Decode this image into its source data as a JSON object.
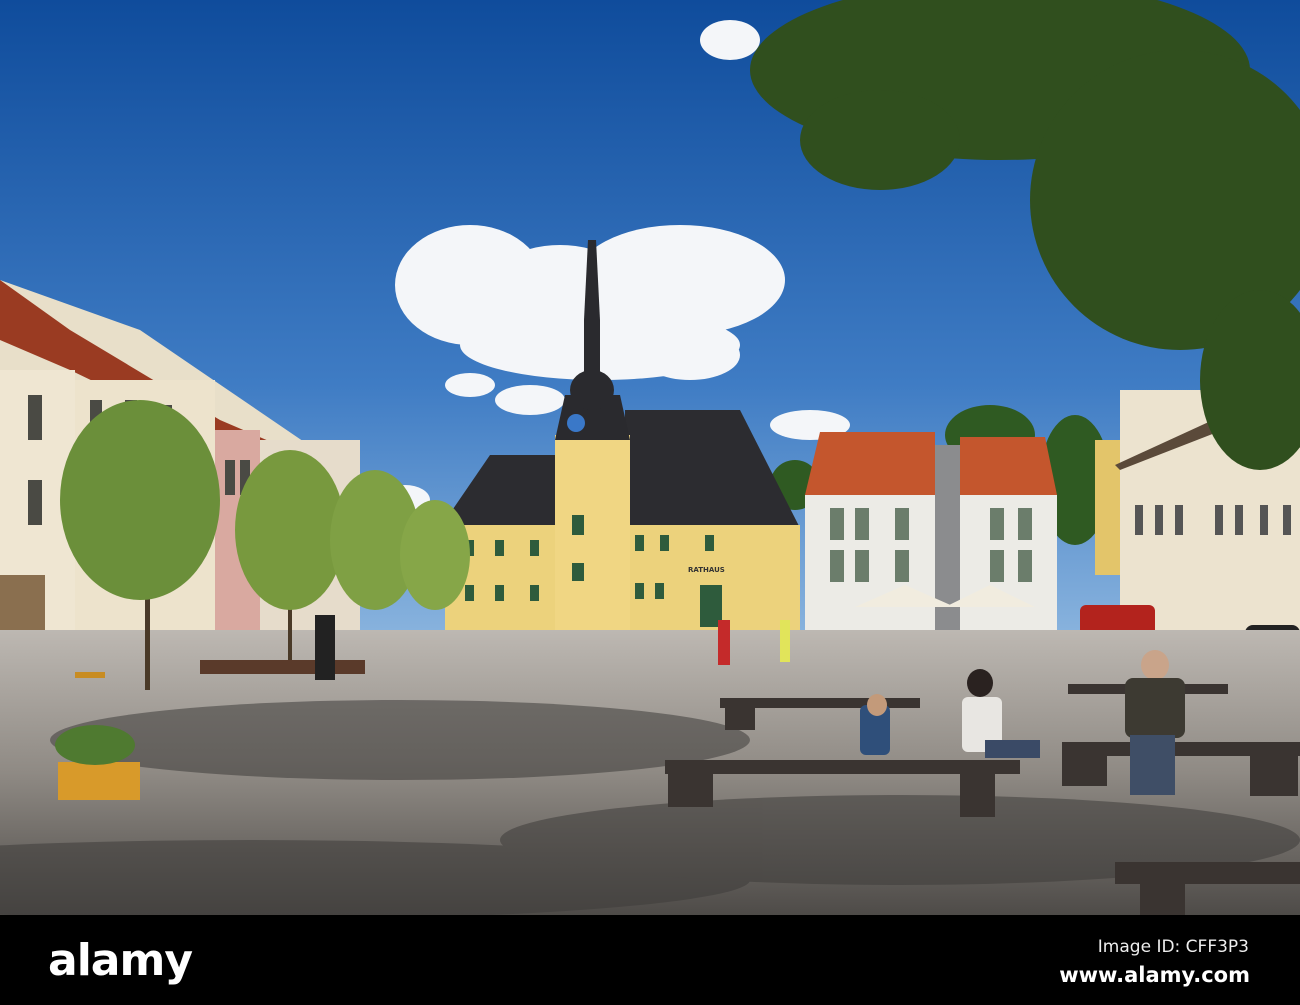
{
  "photo": {
    "building_sign": "RATHAUS"
  },
  "footer": {
    "logo": "alamy",
    "image_id": "Image ID: CFF3P3",
    "url": "www.alamy.com"
  }
}
